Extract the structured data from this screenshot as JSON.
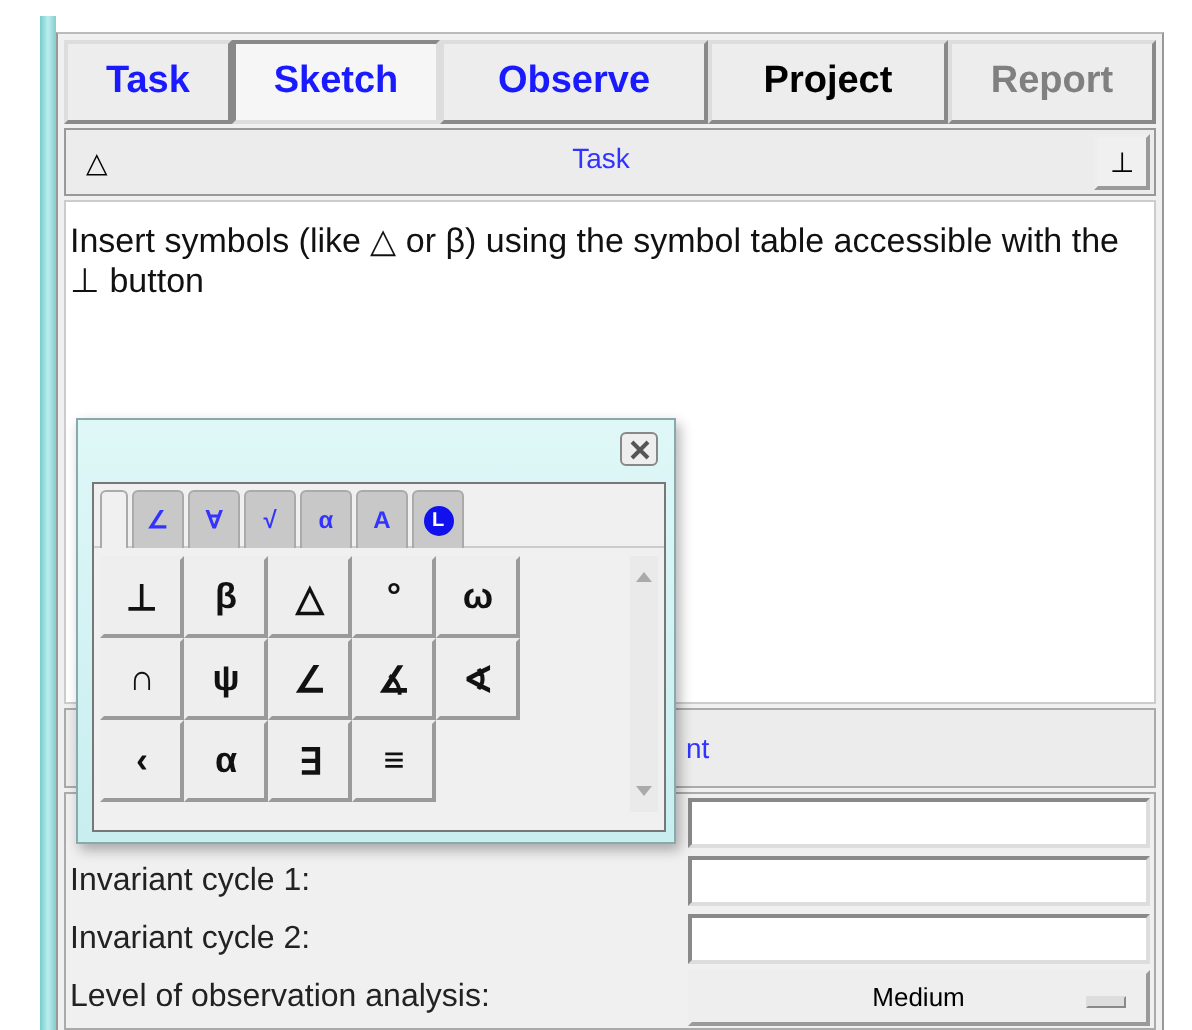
{
  "tabs": [
    {
      "label": "Task",
      "selected": false,
      "color": "#1a1aff"
    },
    {
      "label": "Sketch",
      "selected": true,
      "color": "#1a1aff"
    },
    {
      "label": "Observe",
      "selected": false,
      "color": "#1a1aff"
    },
    {
      "label": "Project",
      "selected": false,
      "color": "#000000"
    },
    {
      "label": "Report",
      "selected": false,
      "color": "#808080"
    }
  ],
  "header": {
    "symbol": "△",
    "title": "Task",
    "button": "⊥"
  },
  "task_text": "Insert symbols (like △ or β) using the symbol table accessible with the ⊥ button",
  "section": {
    "title": "nt"
  },
  "form": [
    {
      "kind": "field"
    },
    {
      "kind": "field",
      "label": "Invariant cycle 1:"
    },
    {
      "kind": "field",
      "label": "Invariant cycle 2:"
    },
    {
      "kind": "dropdown",
      "label": "Level of observation analysis:",
      "value": "Medium"
    }
  ],
  "palette": {
    "tabs": [
      {
        "selected": true
      },
      {
        "label": "∠",
        "selected": false,
        "kind": "text"
      },
      {
        "label": "∀",
        "selected": false,
        "kind": "text"
      },
      {
        "label": "√",
        "selected": false,
        "kind": "text"
      },
      {
        "label": "α",
        "selected": false,
        "kind": "text"
      },
      {
        "label": "A",
        "selected": false,
        "kind": "text"
      },
      {
        "label": "L",
        "selected": false,
        "kind": "circle"
      }
    ],
    "symbols": [
      "⊥",
      "β",
      "△",
      "°",
      "ω",
      "∩",
      "ψ",
      "∠",
      "∡",
      "∢",
      "‹",
      "α",
      "∃",
      "≡"
    ]
  }
}
